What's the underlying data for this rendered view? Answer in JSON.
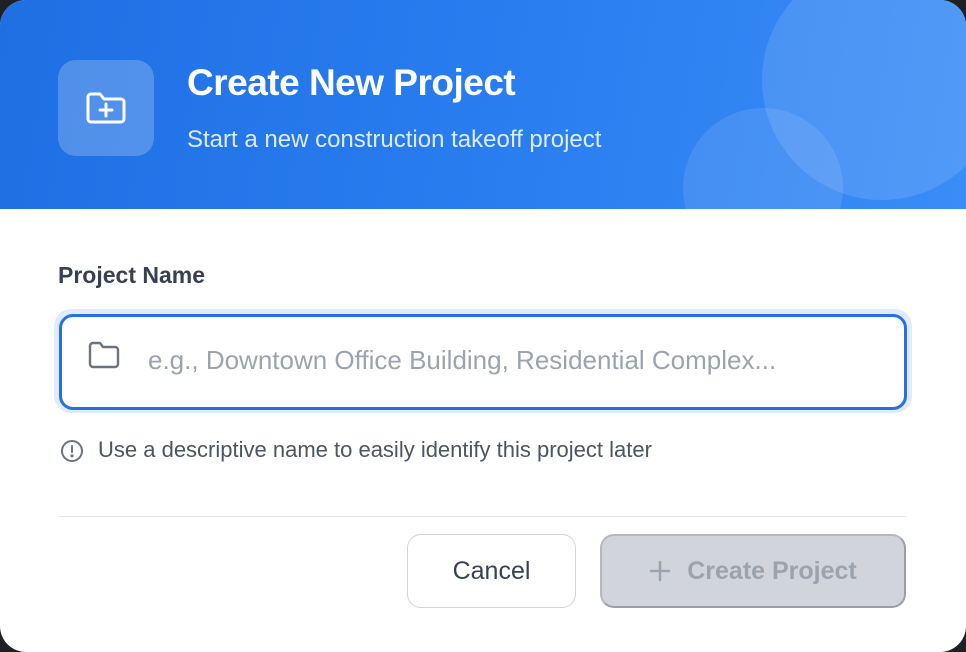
{
  "dialog": {
    "title": "Create New Project",
    "subtitle": "Start a new construction takeoff project",
    "header_icon": "folder-plus-icon"
  },
  "form": {
    "label": "Project Name",
    "input_value": "",
    "input_placeholder": "e.g., Downtown Office Building, Residential Complex...",
    "input_icon": "folder-icon",
    "hint": "Use a descriptive name to easily identify this project later",
    "hint_icon": "info-circle-icon"
  },
  "actions": {
    "cancel_label": "Cancel",
    "create_label": "Create Project",
    "create_icon": "plus-icon",
    "create_disabled": true
  },
  "colors": {
    "accent": "#2570e6",
    "header_gradient_start": "#1f6fe3",
    "header_gradient_end": "#3a8cf6",
    "disabled_button_bg": "#d1d5db",
    "disabled_button_text": "#9ca3af"
  }
}
